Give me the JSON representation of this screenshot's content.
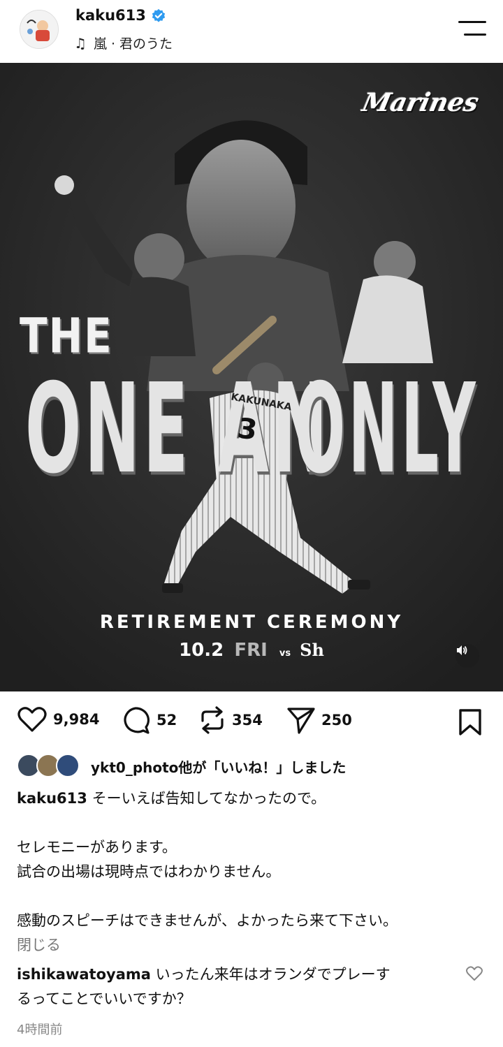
{
  "header": {
    "username": "kaku613",
    "music": "嵐 · 君のうた",
    "icons": [
      "avatar",
      "verified-badge-icon",
      "music-note-icon",
      "menu-icon"
    ]
  },
  "poster": {
    "brand": "Marines",
    "line1": "THE",
    "line2a": "ONE AN",
    "line2b": "ONLY",
    "jersey_name": "KAKUNAKA",
    "jersey_number": "3",
    "ceremony": "RETIREMENT CEREMONY",
    "date": "10.2",
    "day": "FRI",
    "vs": "vs",
    "opponent": "Sh"
  },
  "actions": {
    "likes": "9,984",
    "comments": "52",
    "reposts": "354",
    "shares": "250"
  },
  "liked_by": {
    "text": "ykt0_photo他が「いいね！」しました"
  },
  "caption": {
    "user": "kaku613",
    "line1": "そーいえば告知してなかったので。",
    "line2": "セレモニーがあります。",
    "line3": "試合の出場は現時点ではわかりません。",
    "line4": "感動のスピーチはできませんが、よかったら来て下さい。",
    "close": "閉じる"
  },
  "comment": {
    "user": "ishikawatoyama",
    "text_line1": "いったん来年はオランダでプレーす",
    "text_line2": "るってことでいいですか？",
    "time": "4時間前"
  },
  "colors": {
    "poster_bg": "#2a2a2a",
    "verified": "#2e9bf0",
    "muted_text": "#777777"
  }
}
